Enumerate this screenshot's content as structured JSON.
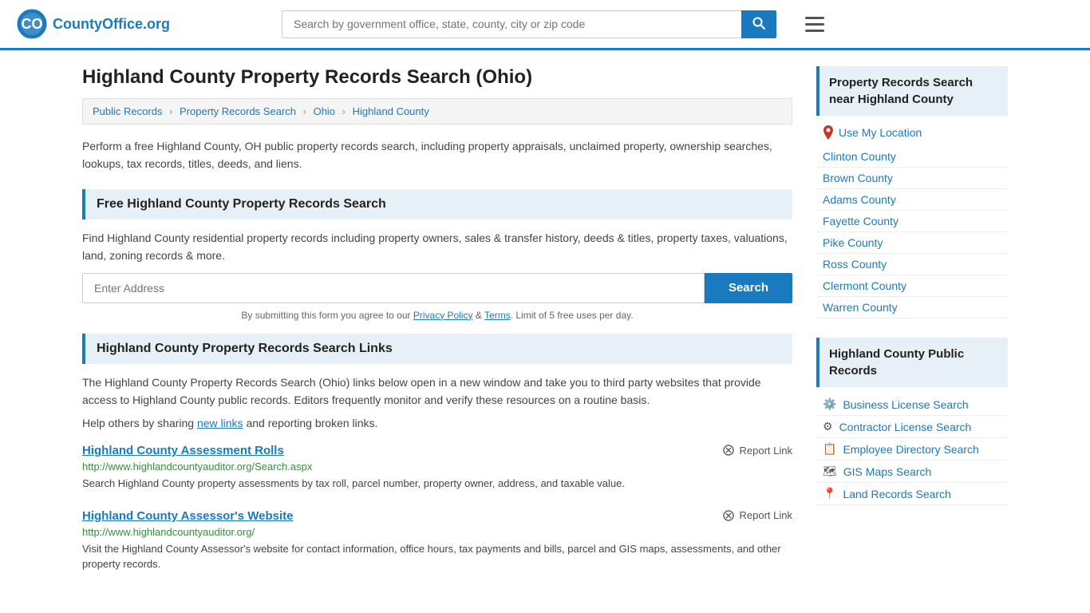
{
  "header": {
    "logo_text": "CountyOffice",
    "logo_suffix": ".org",
    "search_placeholder": "Search by government office, state, county, city or zip code"
  },
  "page": {
    "title": "Highland County Property Records Search (Ohio)",
    "breadcrumb": [
      {
        "label": "Public Records",
        "href": "#"
      },
      {
        "label": "Property Records Search",
        "href": "#"
      },
      {
        "label": "Ohio",
        "href": "#"
      },
      {
        "label": "Highland County",
        "href": "#"
      }
    ],
    "intro_text": "Perform a free Highland County, OH public property records search, including property appraisals, unclaimed property, ownership searches, lookups, tax records, titles, deeds, and liens."
  },
  "free_search": {
    "section_title": "Free Highland County Property Records Search",
    "description": "Find Highland County residential property records including property owners, sales & transfer history, deeds & titles, property taxes, valuations, land, zoning records & more.",
    "address_placeholder": "Enter Address",
    "search_button": "Search",
    "disclaimer": "By submitting this form you agree to our",
    "privacy_policy": "Privacy Policy",
    "terms": "Terms",
    "limit_text": "Limit of 5 free uses per day."
  },
  "links_section": {
    "section_title": "Highland County Property Records Search Links",
    "description": "The Highland County Property Records Search (Ohio) links below open in a new window and take you to third party websites that provide access to Highland County public records. Editors frequently monitor and verify these resources on a routine basis.",
    "share_text": "Help others by sharing",
    "new_links_text": "new links",
    "reporting_text": "and reporting broken links.",
    "records": [
      {
        "title": "Highland County Assessment Rolls",
        "url": "http://www.highlandcountyauditor.org/Search.aspx",
        "description": "Search Highland County property assessments by tax roll, parcel number, property owner, address, and taxable value.",
        "report_label": "Report Link"
      },
      {
        "title": "Highland County Assessor's Website",
        "url": "http://www.highlandcountyauditor.org/",
        "description": "Visit the Highland County Assessor's website for contact information, office hours, tax payments and bills, parcel and GIS maps, assessments, and other property records.",
        "report_label": "Report Link"
      }
    ]
  },
  "sidebar": {
    "nearby_section_title": "Property Records Search near Highland County",
    "use_my_location": "Use My Location",
    "nearby_counties": [
      "Clinton County",
      "Brown County",
      "Adams County",
      "Fayette County",
      "Pike County",
      "Ross County",
      "Clermont County",
      "Warren County"
    ],
    "public_records_title": "Highland County Public Records",
    "public_records_links": [
      {
        "label": "Business License Search",
        "icon": "⚙️"
      },
      {
        "label": "Contractor License Search",
        "icon": "⚙"
      },
      {
        "label": "Employee Directory Search",
        "icon": "📋"
      },
      {
        "label": "GIS Maps Search",
        "icon": "🗺"
      },
      {
        "label": "Land Records Search",
        "icon": "📍"
      }
    ]
  }
}
